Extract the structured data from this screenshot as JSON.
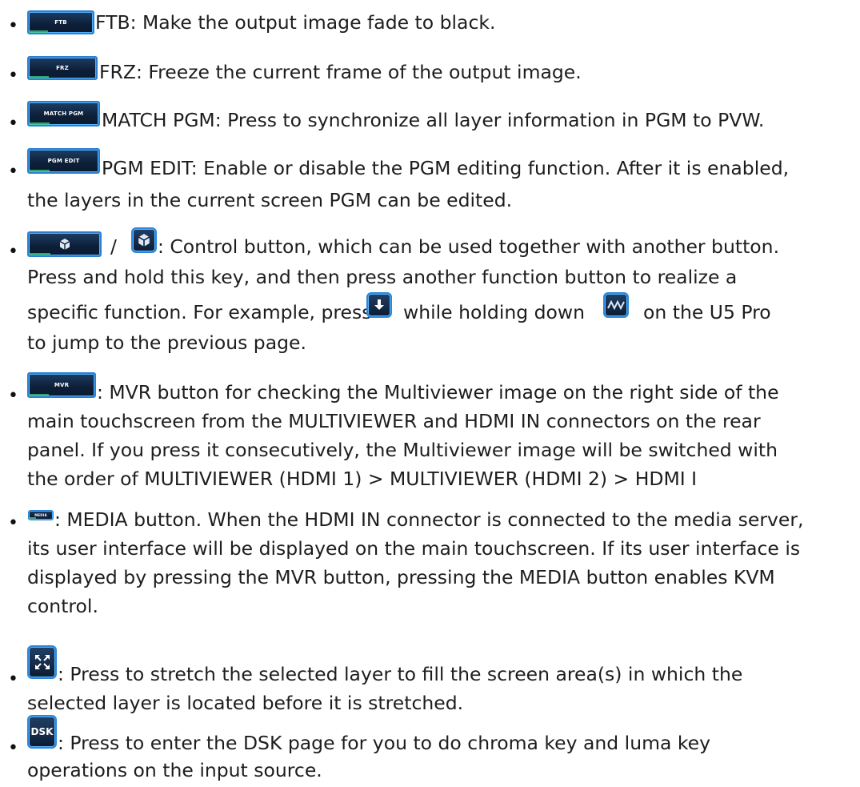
{
  "items": [
    {
      "button_label": "FTB",
      "lines": [
        "FTB: Make the output image fade to black."
      ]
    },
    {
      "button_label": "FRZ",
      "lines": [
        "FRZ: Freeze the current frame of the output image."
      ]
    },
    {
      "button_label": "MATCH PGM",
      "lines": [
        "MATCH PGM: Press to synchronize all layer information in PGM to PVW."
      ]
    },
    {
      "button_label": "PGM EDIT",
      "lines": [
        "PGM EDIT: Enable or disable the PGM editing function. After it is enabled,",
        "the layers in the current screen PGM can be edited."
      ]
    },
    {
      "separator": "/",
      "lines": [
        ": Control button, which can be used together with another button.",
        "Press and hold this key, and then press another function button to realize a",
        "specific function. For example, press",
        "while holding down",
        "on the U5 Pro",
        "to jump to the previous page."
      ]
    },
    {
      "button_label": "MVR",
      "lines": [
        ": MVR button for checking the Multiviewer image on the right side of the",
        "main touchscreen from the MULTIVIEWER and HDMI IN connectors on the rear",
        "panel. If you press it consecutively, the Multiviewer image will be switched with",
        "the order of MULTIVIEWER (HDMI 1) > MULTIVIEWER (HDMI 2) > HDMI I"
      ]
    },
    {
      "button_label": "MEDIA",
      "lines": [
        ": MEDIA button. When the HDMI IN connector is connected to the media server,",
        "its user interface will be displayed on the main touchscreen. If its user interface is",
        "displayed by pressing the MVR button, pressing the MEDIA button enables KVM",
        "control."
      ]
    },
    {
      "lines": [
        ": Press to stretch the selected layer to fill the screen area(s) in which the",
        "selected layer is located before it is stretched."
      ]
    },
    {
      "button_label": "DSK",
      "lines": [
        ": Press to enter the DSK page for you to do chroma key and luma key",
        "operations on the input source."
      ]
    }
  ],
  "colors": {
    "text": "#1d1d1d",
    "button_bg": "#0d1f38",
    "button_border": "#2a7fd0",
    "button_glow": "#4fb2ff"
  }
}
